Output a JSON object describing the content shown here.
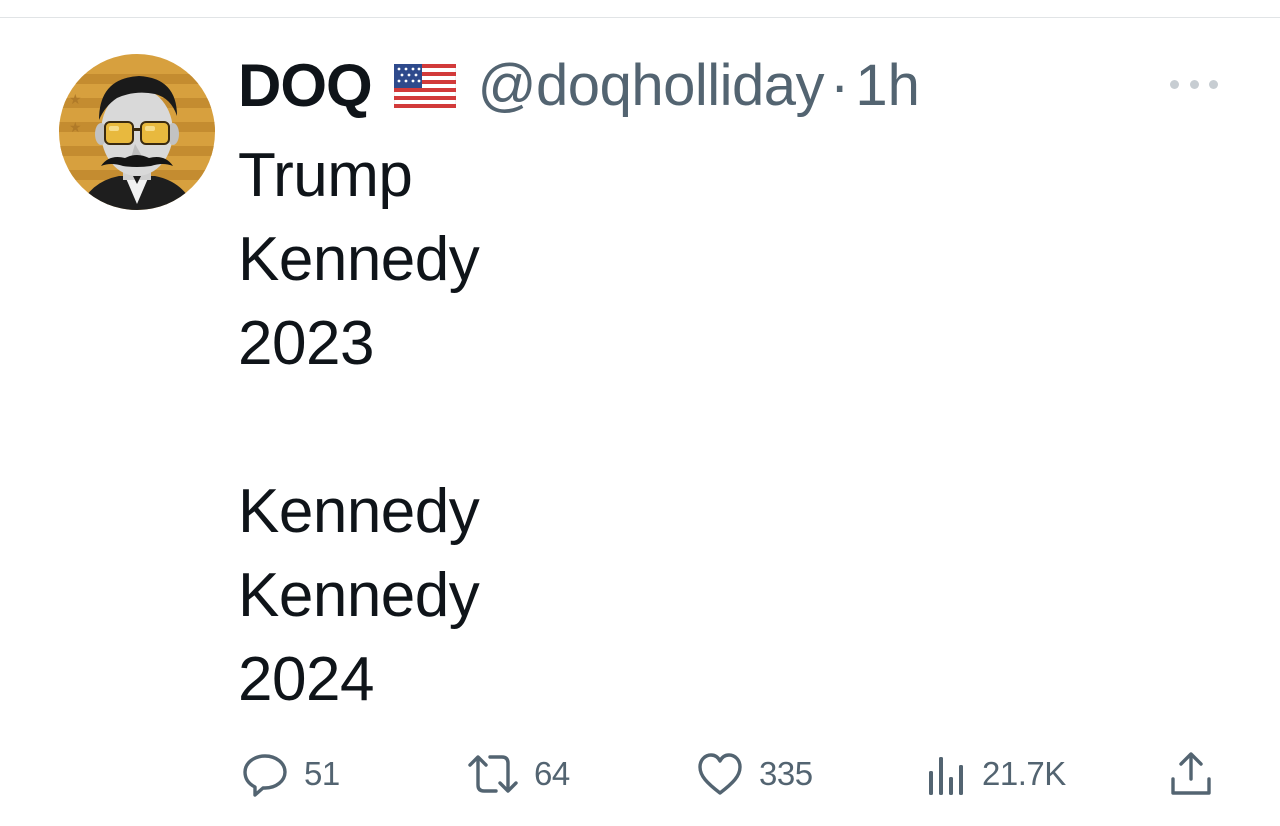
{
  "tweet": {
    "author": {
      "display_name": "DOQ",
      "flag_icon": "us-flag-icon",
      "handle": "@doqholliday",
      "separator": "·",
      "timestamp": "1h",
      "avatar_icon": "avatar-mustache-sunglasses"
    },
    "more_icon": "more-dots-icon",
    "body_lines": [
      "Trump",
      "Kennedy",
      "2023",
      "",
      "Kennedy",
      "Kennedy",
      "2024"
    ],
    "actions": {
      "reply": {
        "icon": "reply-icon",
        "count": "51"
      },
      "retweet": {
        "icon": "retweet-icon",
        "count": "64"
      },
      "like": {
        "icon": "heart-icon",
        "count": "335"
      },
      "views": {
        "icon": "views-chart-icon",
        "count": "21.7K"
      },
      "share": {
        "icon": "share-icon"
      }
    }
  },
  "colors": {
    "text_primary": "#0f1419",
    "text_secondary": "#536471",
    "divider": "#e1e4e6",
    "avatar_bg": "#d9a441"
  }
}
